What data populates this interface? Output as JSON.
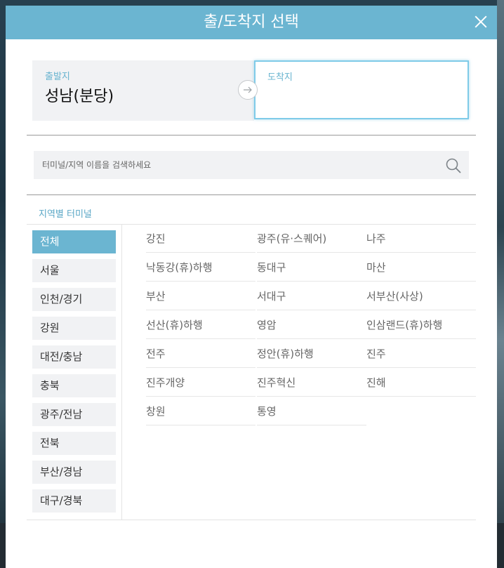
{
  "modal": {
    "title": "출/도착지 선택",
    "close_label": "×"
  },
  "route": {
    "departure_label": "출발지",
    "departure_value": "성남(분당)",
    "arrival_label": "도착지",
    "arrival_value": ""
  },
  "search": {
    "placeholder": "터미널/지역 이름을 검색하세요",
    "value": ""
  },
  "section_title": "지역별 터미널",
  "regions": [
    {
      "label": "전체",
      "active": true
    },
    {
      "label": "서울",
      "active": false
    },
    {
      "label": "인천/경기",
      "active": false
    },
    {
      "label": "강원",
      "active": false
    },
    {
      "label": "대전/충남",
      "active": false
    },
    {
      "label": "충북",
      "active": false
    },
    {
      "label": "광주/전남",
      "active": false
    },
    {
      "label": "전북",
      "active": false
    },
    {
      "label": "부산/경남",
      "active": false
    },
    {
      "label": "대구/경북",
      "active": false
    }
  ],
  "terminals": [
    "강진",
    "광주(유·스퀘어)",
    "나주",
    "낙동강(휴)하행",
    "동대구",
    "마산",
    "부산",
    "서대구",
    "서부산(사상)",
    "선산(휴)하행",
    "영암",
    "인삼랜드(휴)하행",
    "전주",
    "정안(휴)하행",
    "진주",
    "진주개양",
    "진주혁신",
    "진해",
    "창원",
    "통영"
  ],
  "colors": {
    "accent": "#6bb5d1",
    "label": "#67b3cf",
    "panel": "#f1f2f4"
  },
  "icons": {
    "close": "close-icon",
    "arrow": "arrow-right-icon",
    "search": "search-icon"
  }
}
